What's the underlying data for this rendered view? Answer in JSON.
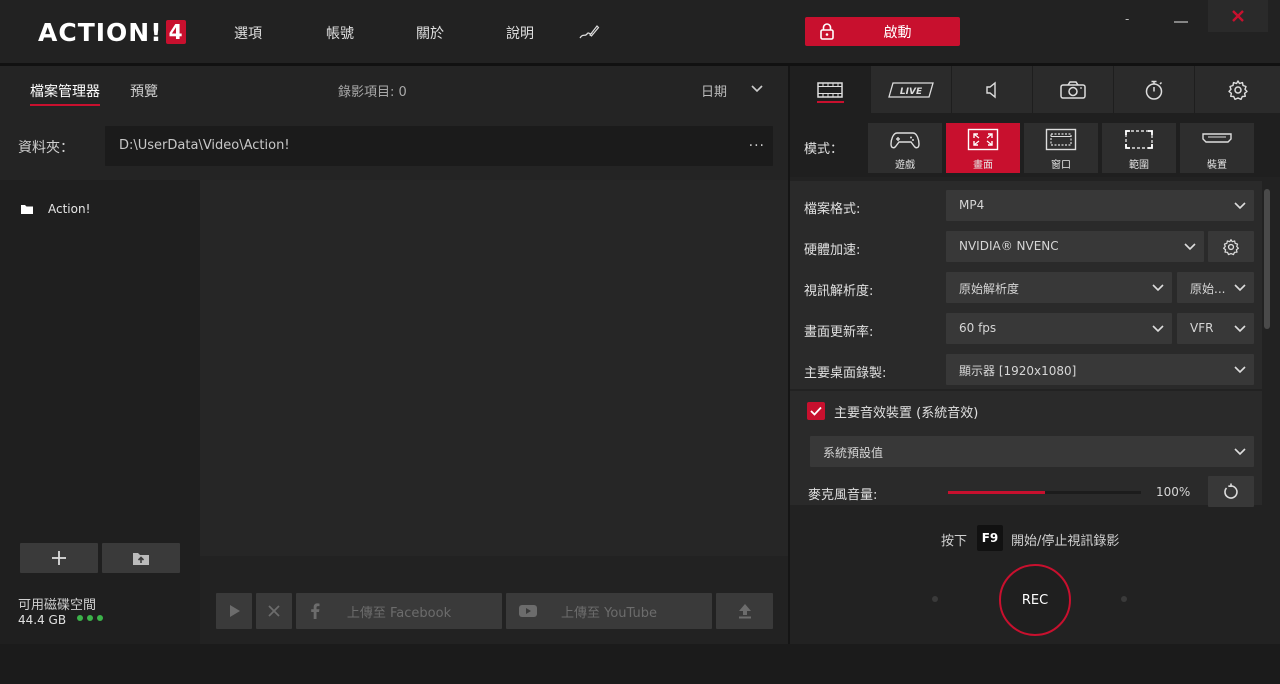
{
  "app": {
    "logo_text": "ACTION!",
    "logo_version": "4",
    "menu": [
      "選項",
      "帳號",
      "關於",
      "說明"
    ],
    "start_label": "啟動",
    "window_controls": {
      "minimize": "-",
      "close": "×"
    }
  },
  "left": {
    "tabs": [
      {
        "label": "檔案管理器",
        "active": true
      },
      {
        "label": "預覽",
        "active": false
      }
    ],
    "recording_count": "錄影項目: 0",
    "sort_label": "日期",
    "folder_label": "資料夾：",
    "folder_path": "D:\\UserData\\Video\\Action!",
    "folder_more": "...",
    "tree_items": [
      "Action!"
    ],
    "disk_label": "可用磁碟空間",
    "disk_value": "44.4 GB",
    "footer_buttons": {
      "facebook": "上傳至 Facebook",
      "youtube": "上傳至 YouTube"
    }
  },
  "right": {
    "tabs": [
      "video-icon",
      "live-icon",
      "audio-icon",
      "camera-icon",
      "timer-icon",
      "gear-icon"
    ],
    "live_label": "LIVE",
    "mode_label": "模式：",
    "modes": [
      {
        "label": "遊戲",
        "active": false
      },
      {
        "label": "畫面",
        "active": true
      },
      {
        "label": "窗口",
        "active": false
      },
      {
        "label": "範圍",
        "active": false
      },
      {
        "label": "裝置",
        "active": false
      }
    ],
    "settings": {
      "format": {
        "label": "檔案格式:",
        "value": "MP4"
      },
      "hw": {
        "label": "硬體加速:",
        "value": "NVIDIA® NVENC"
      },
      "resolution": {
        "label": "視訊解析度:",
        "value": "原始解析度",
        "value2": "原始..."
      },
      "framerate": {
        "label": "畫面更新率:",
        "value": "60 fps",
        "value2": "VFR"
      },
      "desktop": {
        "label": "主要桌面錄製:",
        "value": "顯示器 [1920x1080]"
      }
    },
    "audio": {
      "checkbox_label": "主要音效裝置 (系統音效)",
      "checked": true,
      "device": "系統預設值",
      "mic_label": "麥克風音量:",
      "mic_volume": "100%",
      "mic_slider_fraction": 0.5
    },
    "hotkey": {
      "pre": "按下",
      "key": "F9",
      "post": "開始/停止視訊錄影"
    },
    "rec_label": "REC"
  },
  "colors": {
    "accent": "#c8102e",
    "disk_ok": "#3cb34a"
  }
}
